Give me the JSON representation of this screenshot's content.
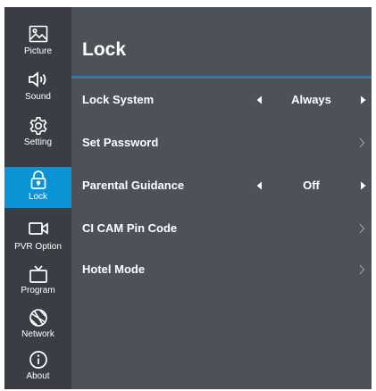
{
  "sidebar": {
    "items": [
      {
        "label": "Picture",
        "icon": "picture-icon"
      },
      {
        "label": "Sound",
        "icon": "speaker-icon"
      },
      {
        "label": "Setting",
        "icon": "gear-icon"
      },
      {
        "label": "Lock",
        "icon": "lock-icon",
        "active": true
      },
      {
        "label": "PVR Option",
        "icon": "camera-icon"
      },
      {
        "label": "Program",
        "icon": "tv-icon"
      },
      {
        "label": "Network",
        "icon": "globe-icon"
      },
      {
        "label": "About",
        "icon": "info-icon"
      }
    ]
  },
  "main": {
    "title": "Lock",
    "rows": [
      {
        "label": "Lock System",
        "value": "Always",
        "control": "selector"
      },
      {
        "label": "Set Password",
        "control": "submenu"
      },
      {
        "label": "Parental Guidance",
        "value": "Off",
        "control": "selector"
      },
      {
        "label": "CI CAM Pin Code",
        "control": "submenu"
      },
      {
        "label": "Hotel Mode",
        "control": "submenu"
      }
    ]
  },
  "colors": {
    "sidebar_bg": "#3a3e44",
    "panel_bg": "#4d5259",
    "active_accent": "#0a94d6",
    "title_underline": "#2a7fae",
    "text": "#ffffff"
  }
}
